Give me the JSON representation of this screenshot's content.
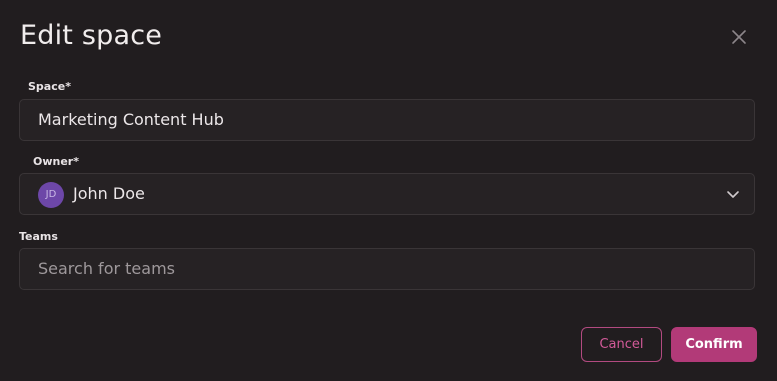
{
  "dialog": {
    "title": "Edit space",
    "close_icon": "close-icon"
  },
  "space": {
    "label": "Space*",
    "value": "Marketing Content Hub"
  },
  "owner": {
    "label": "Owner*",
    "avatar_initials": "JD",
    "name": "John Doe",
    "dropdown_icon": "chevron-down-icon"
  },
  "teams": {
    "label": "Teams",
    "placeholder": "Search for teams"
  },
  "actions": {
    "cancel_label": "Cancel",
    "confirm_label": "Confirm"
  },
  "colors": {
    "background": "#211d1f",
    "field_background": "#262224",
    "accent": "#b23a78",
    "avatar": "#6d47a8"
  }
}
